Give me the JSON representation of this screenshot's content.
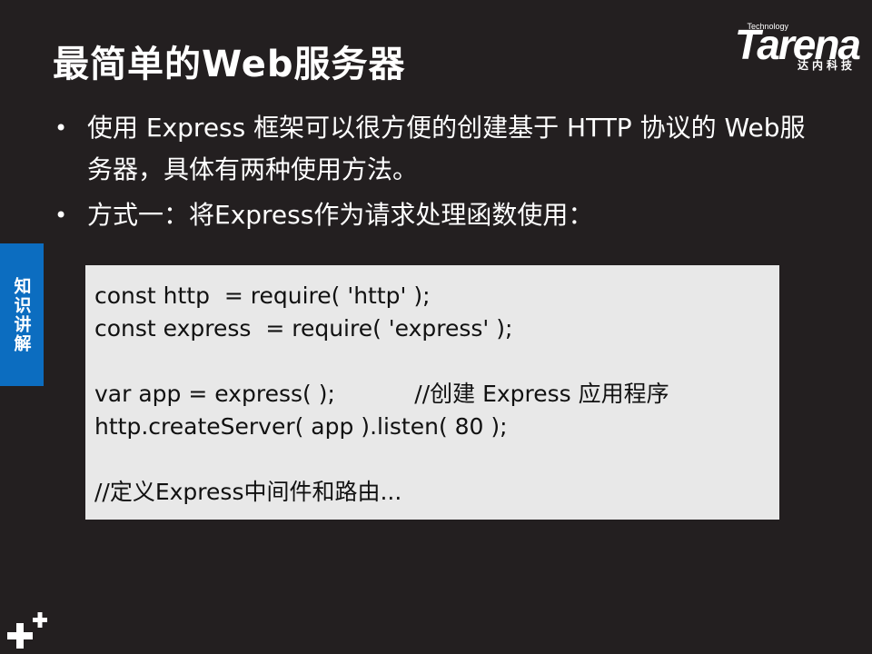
{
  "slide": {
    "title": "最简单的Web服务器"
  },
  "logo": {
    "tagline": "Technology",
    "wordmark": "Tarena",
    "chinese": "达内科技"
  },
  "side_tab": {
    "label": "知识讲解",
    "color": "#0c6dc0"
  },
  "bullets": [
    {
      "text": "使用 Express 框架可以很方便的创建基于 HTTP 协议的 Web服务器，具体有两种使用方法。"
    },
    {
      "text": "方式一：将Express作为请求处理函数使用："
    }
  ],
  "code": {
    "lines": [
      "const http  = require( 'http' );",
      "const express  = require( 'express' );",
      "",
      "var app = express( );           //创建 Express 应用程序",
      "http.createServer( app ).listen( 80 );",
      "",
      "//定义Express中间件和路由..."
    ]
  },
  "colors": {
    "background": "#231f20",
    "code_background": "#e8e8e8"
  },
  "icons": {
    "corner": "plus-icon"
  }
}
